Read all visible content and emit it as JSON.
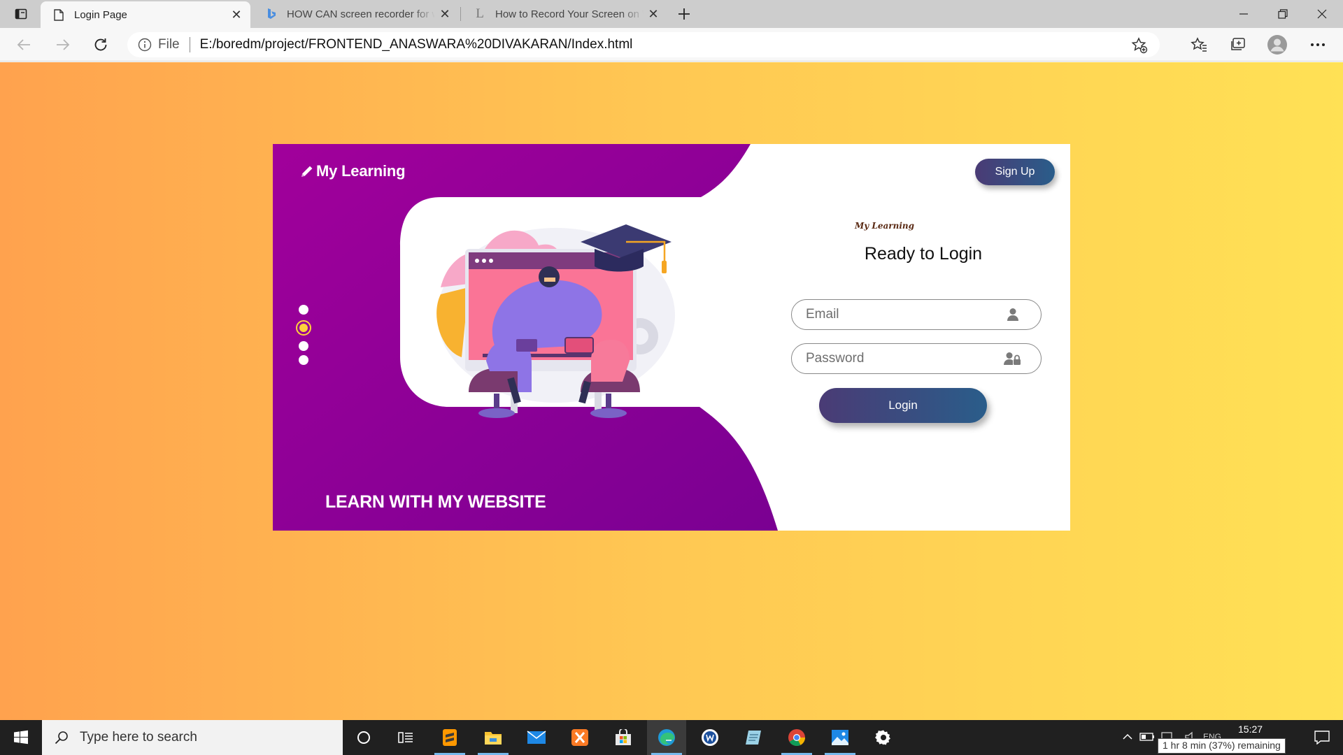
{
  "browser": {
    "tabs": [
      {
        "title": "Login Page",
        "active": true
      },
      {
        "title": "HOW CAN screen recorder for w",
        "active": false
      },
      {
        "title": "How to Record Your Screen on W",
        "active": false
      }
    ],
    "address": {
      "scheme_label": "File",
      "url": "E:/boredm/project/FRONTEND_ANASWARA%20DIVAKARAN/Index.html"
    }
  },
  "page": {
    "brand": "My Learning",
    "tagline": "LEARN WITH MY WEBSITE",
    "slider": {
      "count": 4,
      "active_index": 1
    },
    "signup_label": "Sign Up",
    "mini_logo": "My Learning",
    "form_title": "Ready to Login",
    "email_placeholder": "Email",
    "password_placeholder": "Password",
    "login_label": "Login"
  },
  "taskbar": {
    "search_placeholder": "Type here to search",
    "clock": "15:27",
    "language": "ENG",
    "battery_tooltip": "1 hr 8 min (37%) remaining"
  },
  "colors": {
    "purple": "#8e0096",
    "button_gradient_start": "#4a3b75",
    "button_gradient_end": "#2a5d8a",
    "bg_gradient_start": "#ffa24e",
    "bg_gradient_end": "#ffe155",
    "slider_active": "#ffd23c"
  }
}
